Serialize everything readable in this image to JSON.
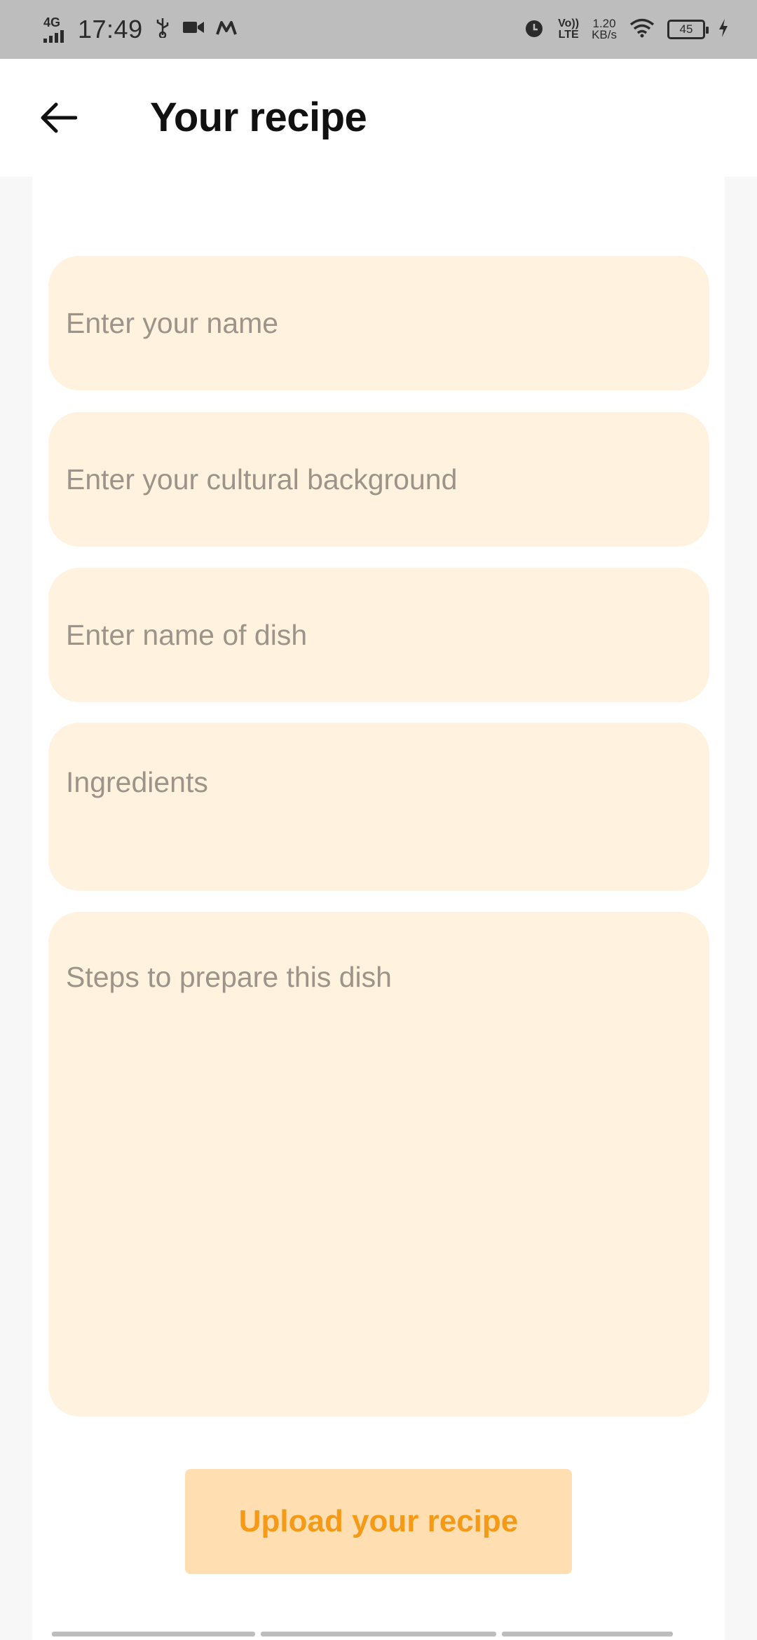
{
  "status_bar": {
    "network": "4G",
    "time": "17:49",
    "usb_icon": "usb-icon",
    "video_icon": "video-camera-icon",
    "app_icon": "m-logo-icon",
    "alarm_icon": "alarm-clock-icon",
    "volte_line1": "Vo))",
    "volte_line2": "LTE",
    "speed_value": "1.20",
    "speed_unit": "KB/s",
    "wifi_icon": "wifi-icon",
    "battery_level": "45",
    "charging_icon": "lightning-bolt-icon"
  },
  "header": {
    "back_icon": "arrow-left-icon",
    "title": "Your recipe"
  },
  "form": {
    "name_placeholder": "Enter your name",
    "culture_placeholder": "Enter your cultural background",
    "dish_placeholder": "Enter name of dish",
    "ingredients_placeholder": "Ingredients",
    "steps_placeholder": "Steps to prepare this dish",
    "name_value": "",
    "culture_value": "",
    "dish_value": "",
    "ingredients_value": "",
    "steps_value": ""
  },
  "actions": {
    "upload_label": "Upload your recipe"
  },
  "colors": {
    "field_bg": "#fff2df",
    "placeholder": "#9c9489",
    "button_bg": "#ffdfb1",
    "button_text": "#f49a17",
    "status_bar_bg": "#bdbdbd"
  }
}
